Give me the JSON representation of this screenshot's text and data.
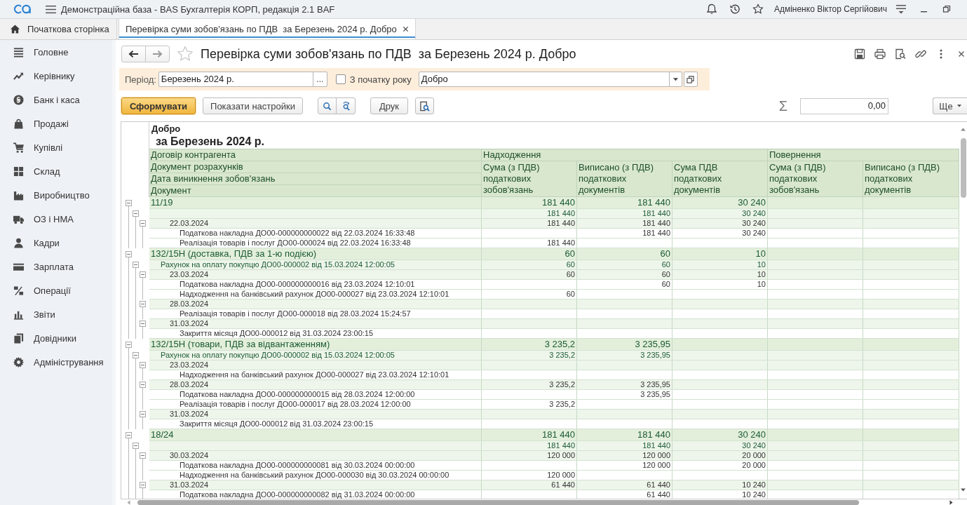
{
  "app_bar": {
    "title": "Демонстраційна база - BAS Бухгалтерія КОРП, редакція 2.1 BAF",
    "user": "Адміненко Віктор Сергійович"
  },
  "tabs": [
    {
      "label": "Початкова сторінка",
      "kind": "home",
      "selected": false
    },
    {
      "label": "Перевірка суми зобов'язань по ПДВ  за Березень 2024 р. Добро",
      "kind": "document",
      "selected": true
    }
  ],
  "sidebar": {
    "items": [
      "Головне",
      "Керівнику",
      "Банк і каса",
      "Продажі",
      "Купівлі",
      "Склад",
      "Виробництво",
      "ОЗ і НМА",
      "Кадри",
      "Зарплата",
      "Операції",
      "Звіти",
      "Довідники",
      "Адміністрування"
    ]
  },
  "form": {
    "title": "Перевірка суми зобов'язань по ПДВ  за Березень 2024 р. Добро",
    "period": {
      "label": "Період:",
      "value": "Березень 2024 р.",
      "choose_button": "..."
    },
    "from_year_start": {
      "label": "З початку року",
      "checked": false
    },
    "organization": {
      "value": "Добро"
    }
  },
  "toolbar": {
    "generate": "Сформувати",
    "settings": "Показати настройки",
    "print": "Друк",
    "sum_sign": "Σ",
    "sum_value": "0,00",
    "more": "Ще"
  },
  "report": {
    "title": "Добро",
    "period": "за Березень 2024 р.",
    "header": {
      "row_labels": [
        "Договір контрагента",
        "Документ розрахунків",
        "Дата виникнення зобов'язань",
        "Документ"
      ],
      "column_groups": [
        {
          "label": "Надходження",
          "columns": [
            "Сума (з ПДВ) податкових зобов'язань",
            "Виписано (з ПДВ) податкових документів",
            "Сума ПДВ податкових документів"
          ]
        },
        {
          "label": "Повернення",
          "columns": [
            "Сума (з ПДВ) податкових зобов'язань",
            "Виписано (з ПДВ) податкових документів"
          ]
        }
      ]
    },
    "rows": [
      {
        "label": "11/19",
        "receipt_sum": "181 440",
        "receipt_issued": "181 440",
        "receipt_vat": "30 240",
        "expanded": true,
        "children": [
          {
            "receipt_sum": "181 440",
            "receipt_issued": "181 440",
            "receipt_vat": "30 240",
            "expanded": true,
            "children": [
              {
                "label": "22.03.2024",
                "receipt_sum": "181 440",
                "receipt_issued": "181 440",
                "receipt_vat": "30 240",
                "expanded": true,
                "children": [
                  {
                    "label": "Податкова накладна ДО00-000000000022 від 22.03.2024 16:33:48",
                    "receipt_issued": "181 440",
                    "receipt_vat": "30 240"
                  },
                  {
                    "label": "Реалізація товарів і послуг ДО00-000024 від 22.03.2024 16:33:48",
                    "receipt_sum": "181 440"
                  }
                ]
              }
            ]
          }
        ]
      },
      {
        "label": "132/15Н (доставка, ПДВ за 1-ю подією)",
        "receipt_sum": "60",
        "receipt_issued": "60",
        "receipt_vat": "10",
        "expanded": true,
        "children": [
          {
            "label": "Рахунок на оплату покупцю ДО00-000002 від 15.03.2024 12:00:05",
            "receipt_sum": "60",
            "receipt_issued": "60",
            "receipt_vat": "10",
            "expanded": true,
            "children": [
              {
                "label": "23.03.2024",
                "receipt_sum": "60",
                "receipt_issued": "60",
                "receipt_vat": "10",
                "expanded": true,
                "children": [
                  {
                    "label": "Податкова накладна ДО00-000000000016 від 23.03.2024 12:10:01",
                    "receipt_issued": "60",
                    "receipt_vat": "10"
                  },
                  {
                    "label": "Надходження на банківський рахунок ДО00-000027 від 23.03.2024 12:10:01",
                    "receipt_sum": "60"
                  }
                ]
              },
              {
                "label": "28.03.2024",
                "expanded": true,
                "children": [
                  {
                    "label": "Реалізація товарів і послуг ДО00-000018 від 28.03.2024 15:24:57"
                  }
                ]
              },
              {
                "label": "31.03.2024",
                "expanded": true,
                "children": [
                  {
                    "label": "Закриття місяця ДО00-000012 від 31.03.2024 23:00:15"
                  }
                ]
              }
            ]
          }
        ]
      },
      {
        "label": "132/15Н (товари, ПДВ за відвантаженням)",
        "receipt_sum": "3 235,2",
        "receipt_issued": "3 235,95",
        "expanded": true,
        "children": [
          {
            "label": "Рахунок на оплату покупцю ДО00-000002 від 15.03.2024 12:00:05",
            "receipt_sum": "3 235,2",
            "receipt_issued": "3 235,95",
            "expanded": true,
            "children": [
              {
                "label": "23.03.2024",
                "expanded": true,
                "children": [
                  {
                    "label": "Надходження на банківський рахунок ДО00-000027 від 23.03.2024 12:10:01"
                  }
                ]
              },
              {
                "label": "28.03.2024",
                "receipt_sum": "3 235,2",
                "receipt_issued": "3 235,95",
                "expanded": true,
                "children": [
                  {
                    "label": "Податкова накладна ДО00-000000000015 від 28.03.2024 12:00:00",
                    "receipt_issued": "3 235,95"
                  },
                  {
                    "label": "Реалізація товарів і послуг ДО00-000017 від 28.03.2024 12:00:00",
                    "receipt_sum": "3 235,2"
                  }
                ]
              },
              {
                "label": "31.03.2024",
                "expanded": true,
                "children": [
                  {
                    "label": "Закриття місяця ДО00-000012 від 31.03.2024 23:00:15"
                  }
                ]
              }
            ]
          }
        ]
      },
      {
        "label": "18/24",
        "receipt_sum": "181 440",
        "receipt_issued": "181 440",
        "receipt_vat": "30 240",
        "expanded": true,
        "children": [
          {
            "receipt_sum": "181 440",
            "receipt_issued": "181 440",
            "receipt_vat": "30 240",
            "expanded": true,
            "children": [
              {
                "label": "30.03.2024",
                "receipt_sum": "120 000",
                "receipt_issued": "120 000",
                "receipt_vat": "20 000",
                "expanded": true,
                "children": [
                  {
                    "label": "Податкова накладна ДО00-000000000081 від 30.03.2024 00:00:00",
                    "receipt_issued": "120 000",
                    "receipt_vat": "20 000"
                  },
                  {
                    "label": "Надходження на банківський рахунок ДО00-000030 від 30.03.2024 00:00:00",
                    "receipt_sum": "120 000"
                  }
                ]
              },
              {
                "label": "31.03.2024",
                "receipt_sum": "61 440",
                "receipt_issued": "61 440",
                "receipt_vat": "10 240",
                "expanded": true,
                "children": [
                  {
                    "label": "Податкова накладна ДО00-000000000082 від 31.03.2024 00:00:00",
                    "receipt_issued": "61 440",
                    "receipt_vat": "10 240"
                  }
                ]
              }
            ]
          }
        ]
      }
    ]
  }
}
